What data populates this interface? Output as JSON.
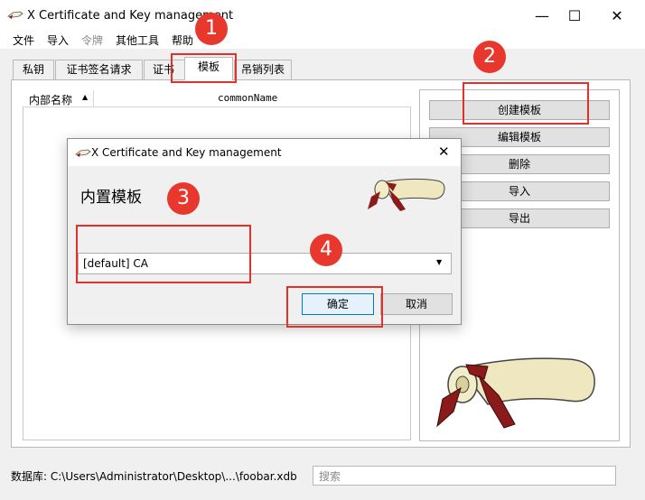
{
  "window": {
    "title": "X Certificate and Key management"
  },
  "menu": [
    "文件",
    "导入",
    "令牌",
    "其他工具",
    "帮助"
  ],
  "tabs": [
    "私钥",
    "证书签名请求",
    "证书",
    "模板",
    "吊销列表"
  ],
  "list": {
    "col_name": "内部名称",
    "col_cn": "commonName"
  },
  "buttons": [
    "创建模板",
    "编辑模板",
    "删除",
    "导入",
    "导出"
  ],
  "statusbar": {
    "db": "数据库: C:\\Users\\Administrator\\Desktop\\...\\foobar.xdb",
    "search_placeholder": "搜索"
  },
  "dialog": {
    "title": "X Certificate and Key management",
    "heading": "内置模板",
    "select_value": "[default] CA",
    "ok": "确定",
    "cancel": "取消"
  },
  "annotations": [
    "1",
    "2",
    "3",
    "4"
  ],
  "colors": {
    "annotation_red": "#e0322b",
    "badge_red": "#e8382e"
  }
}
